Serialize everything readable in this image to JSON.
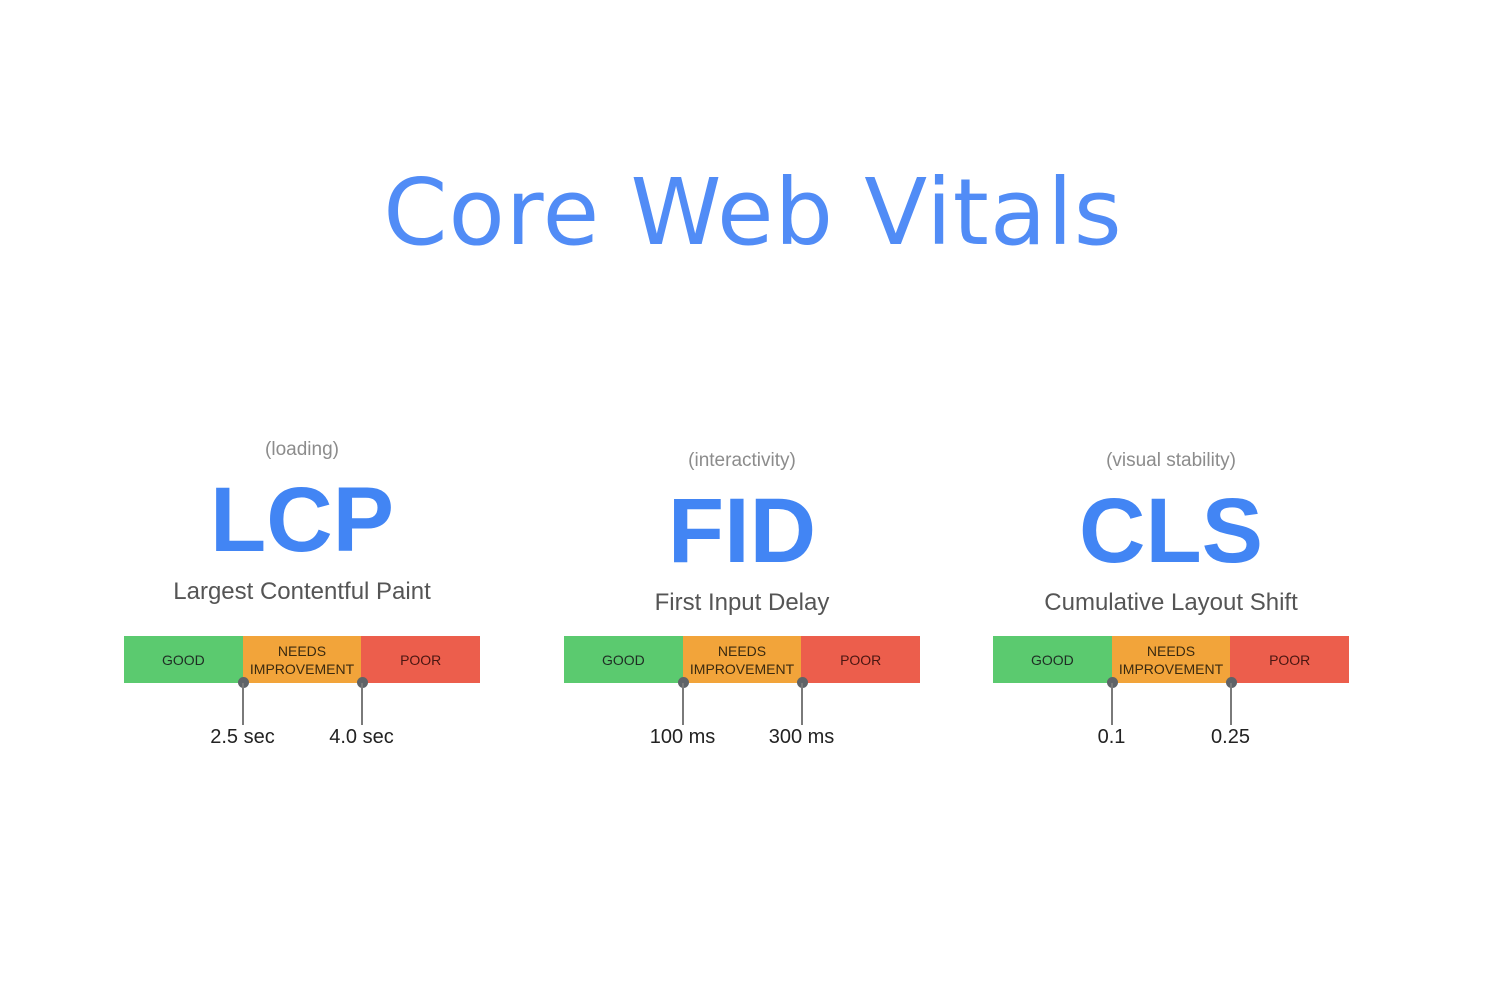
{
  "title": "Core Web Vitals",
  "colors": {
    "title": "#518cf6",
    "abbr": "#4285f4",
    "good": "#5bca6f",
    "needs_improvement": "#f2a43a",
    "poor": "#ec5e4c",
    "marker": "#5f6368"
  },
  "segments": {
    "good": "GOOD",
    "needs_line1": "NEEDS",
    "needs_line2": "IMPROVEMENT",
    "poor": "POOR"
  },
  "metrics": [
    {
      "category": "(loading)",
      "abbr": "LCP",
      "name": "Largest Contentful Paint",
      "thresholds": [
        "2.5 sec",
        "4.0 sec"
      ]
    },
    {
      "category": "(interactivity)",
      "abbr": "FID",
      "name": "First Input Delay",
      "thresholds": [
        "100 ms",
        "300 ms"
      ]
    },
    {
      "category": "(visual stability)",
      "abbr": "CLS",
      "name": "Cumulative Layout Shift",
      "thresholds": [
        "0.1",
        "0.25"
      ]
    }
  ]
}
